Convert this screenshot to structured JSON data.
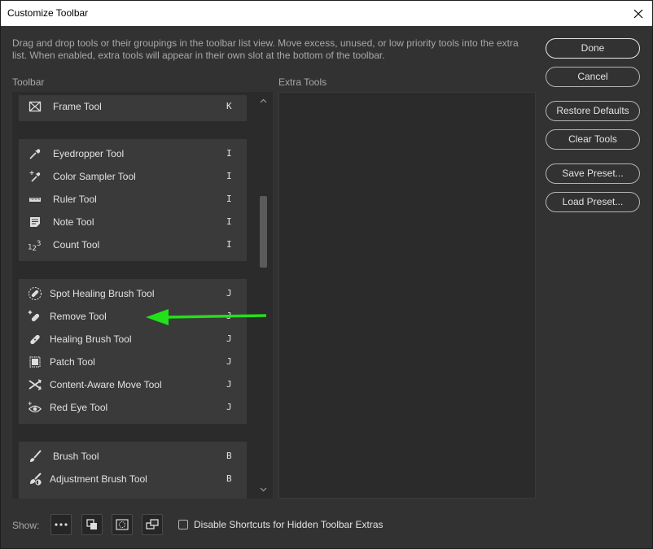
{
  "window": {
    "title": "Customize Toolbar"
  },
  "description": "Drag and drop tools or their groupings in the toolbar list view. Move excess, unused, or low priority tools into the extra list. When enabled, extra tools will appear in their own slot at the bottom of the toolbar.",
  "toolbar_label": "Toolbar",
  "extra_tools_label": "Extra Tools",
  "groups": [
    {
      "tools": [
        {
          "name": "Frame Tool",
          "key": "K",
          "icon": "frame-icon"
        }
      ]
    },
    {
      "tools": [
        {
          "name": "Eyedropper Tool",
          "key": "I",
          "icon": "eyedropper-icon"
        },
        {
          "name": "Color Sampler Tool",
          "key": "I",
          "icon": "color-sampler-icon"
        },
        {
          "name": "Ruler Tool",
          "key": "I",
          "icon": "ruler-icon"
        },
        {
          "name": "Note Tool",
          "key": "I",
          "icon": "note-icon"
        },
        {
          "name": "Count Tool",
          "key": "I",
          "icon": "count-icon"
        }
      ]
    },
    {
      "tools": [
        {
          "name": "Spot Healing Brush Tool",
          "key": "J",
          "icon": "spot-healing-icon"
        },
        {
          "name": "Remove Tool",
          "key": "J",
          "icon": "remove-tool-icon"
        },
        {
          "name": "Healing Brush Tool",
          "key": "J",
          "icon": "healing-brush-icon"
        },
        {
          "name": "Patch Tool",
          "key": "J",
          "icon": "patch-icon"
        },
        {
          "name": "Content-Aware Move Tool",
          "key": "J",
          "icon": "content-aware-move-icon"
        },
        {
          "name": "Red Eye Tool",
          "key": "J",
          "icon": "red-eye-icon"
        }
      ]
    },
    {
      "tools": [
        {
          "name": "Brush Tool",
          "key": "B",
          "icon": "brush-icon"
        },
        {
          "name": "Adjustment Brush Tool",
          "key": "B",
          "icon": "adjustment-brush-icon"
        }
      ]
    }
  ],
  "buttons": {
    "done": "Done",
    "cancel": "Cancel",
    "restore_defaults": "Restore Defaults",
    "clear_tools": "Clear Tools",
    "save_preset": "Save Preset...",
    "load_preset": "Load Preset..."
  },
  "bottom": {
    "show_label": "Show:",
    "disable_shortcuts_label": "Disable Shortcuts for Hidden Toolbar Extras",
    "disable_shortcuts_checked": false
  },
  "colors": {
    "annotation_arrow": "#22e01a",
    "dialog_bg": "#323232",
    "panel_bg": "#2b2b2b"
  }
}
